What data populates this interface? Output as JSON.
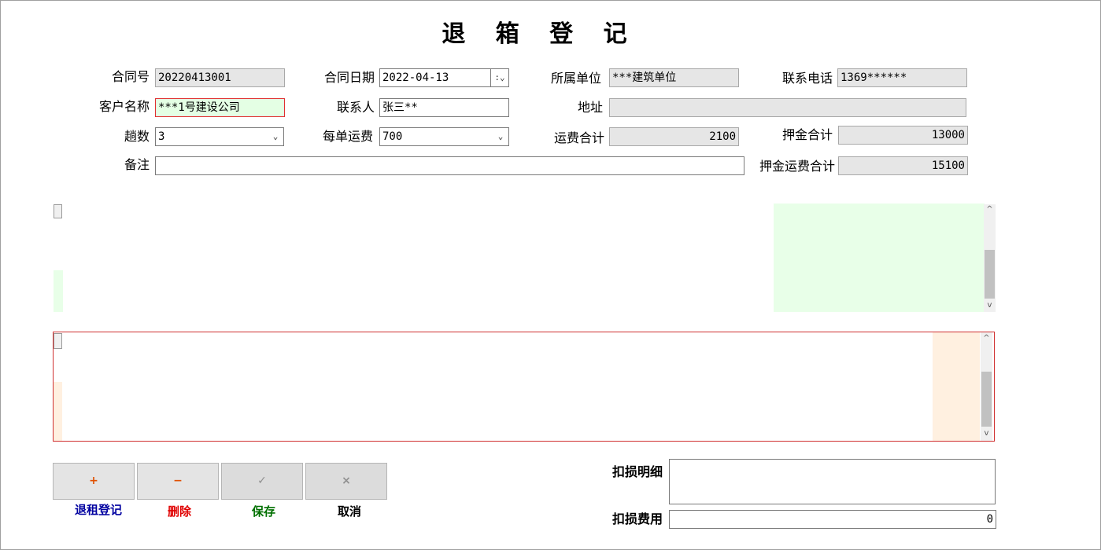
{
  "window": {
    "title": "退 箱 登 记"
  },
  "form": {
    "contract_no": {
      "label": "合同号",
      "value": "20220413001"
    },
    "contract_date": {
      "label": "合同日期",
      "value": "2022-04-13",
      "picker_glyph": ":"
    },
    "company": {
      "label": "所属单位",
      "value": "***建筑单位"
    },
    "phone": {
      "label": "联系电话",
      "value": "1369******"
    },
    "customer": {
      "label": "客户名称",
      "value": "***1号建设公司"
    },
    "contact": {
      "label": "联系人",
      "value": "张三**"
    },
    "address": {
      "label": "地址",
      "value": ""
    },
    "trips": {
      "label": "趟数",
      "value": "3"
    },
    "freight_per": {
      "label": "每单运费",
      "value": "700"
    },
    "freight_total": {
      "label": "运费合计",
      "value": "2100"
    },
    "deposit_total": {
      "label": "押金合计",
      "value": "13000"
    },
    "remark": {
      "label": "备注",
      "value": ""
    },
    "deposit_freight_total": {
      "label": "押金运费合计",
      "value": "15100"
    }
  },
  "toolbar": {
    "add": {
      "glyph": "+",
      "label": "退租登记",
      "color": "#0000a0",
      "glyph_color": "#e05000"
    },
    "delete": {
      "glyph": "−",
      "label": "删除",
      "color": "#e00000",
      "glyph_color": "#e05000"
    },
    "save": {
      "glyph": "✓",
      "label": "保存",
      "color": "#007000",
      "glyph_color": "#909090"
    },
    "cancel": {
      "glyph": "×",
      "label": "取消",
      "color": "#000000",
      "glyph_color": "#909090"
    }
  },
  "damage": {
    "detail": {
      "label": "扣损明细",
      "value": ""
    },
    "fee": {
      "label": "扣损费用",
      "value": "0"
    }
  },
  "grid_arrows": {
    "up": "^",
    "down": "v"
  },
  "icons": {
    "dropdown": "chevron-down-icon",
    "add": "plus-icon",
    "delete": "minus-icon",
    "save": "check-icon",
    "cancel": "close-icon"
  },
  "colors": {
    "required_bg": "#e4ffe4",
    "required_border": "#e03030",
    "grid1_tint": "#e8ffe8",
    "grid2_tint": "#fff0e0",
    "grid2_border": "#d03030",
    "readonly_bg": "#e6e6e6"
  }
}
